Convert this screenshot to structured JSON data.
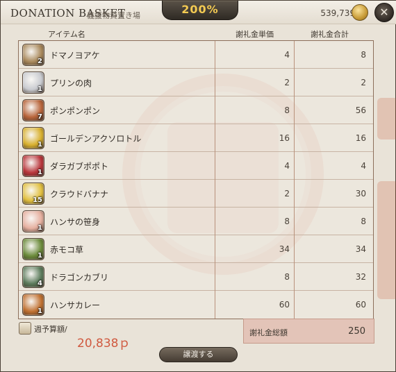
{
  "window": {
    "title": "DONATION BASKET",
    "subtitle": "義援物資置き場",
    "rate": "200%",
    "gil": "539,739"
  },
  "columns": {
    "item": "アイテム名",
    "unit": "謝礼金単価",
    "total": "謝礼金合計"
  },
  "items": [
    {
      "name": "ドマノヨアケ",
      "qty": "2",
      "unit": "4",
      "total": "8",
      "icon": "grain-sack-icon",
      "color": "#a9895c"
    },
    {
      "name": "プリンの肉",
      "qty": "1",
      "unit": "2",
      "total": "2",
      "icon": "pudding-meat-icon",
      "color": "#c9cbd0"
    },
    {
      "name": "ポンポンポン",
      "qty": "7",
      "unit": "8",
      "total": "56",
      "icon": "orange-fruit-icon",
      "color": "#b8643a"
    },
    {
      "name": "ゴールデンアクソロトル",
      "qty": "1",
      "unit": "16",
      "total": "16",
      "icon": "golden-axolotl-icon",
      "color": "#d8b02e"
    },
    {
      "name": "ダラガブポポト",
      "qty": "1",
      "unit": "4",
      "total": "4",
      "icon": "red-fruit-icon",
      "color": "#b8343a"
    },
    {
      "name": "クラウドバナナ",
      "qty": "15",
      "unit": "2",
      "total": "30",
      "icon": "banana-icon",
      "color": "#e2c040"
    },
    {
      "name": "ハンサの笹身",
      "qty": "1",
      "unit": "8",
      "total": "8",
      "icon": "meat-icon",
      "color": "#e6b0a0"
    },
    {
      "name": "赤モコ草",
      "qty": "1",
      "unit": "34",
      "total": "34",
      "icon": "herb-icon",
      "color": "#6a8a3a"
    },
    {
      "name": "ドラゴンカブリ",
      "qty": "4",
      "unit": "8",
      "total": "32",
      "icon": "dragon-turnip-icon",
      "color": "#5a7a5a"
    },
    {
      "name": "ハンサカレー",
      "qty": "1",
      "unit": "60",
      "total": "60",
      "icon": "curry-dish-icon",
      "color": "#c07030"
    }
  ],
  "footer": {
    "budget_label": "週予算額/",
    "budget_value": "20,838ｐ",
    "total_label": "謝礼金総額",
    "total_value": "250",
    "submit_label": "譲渡する"
  }
}
